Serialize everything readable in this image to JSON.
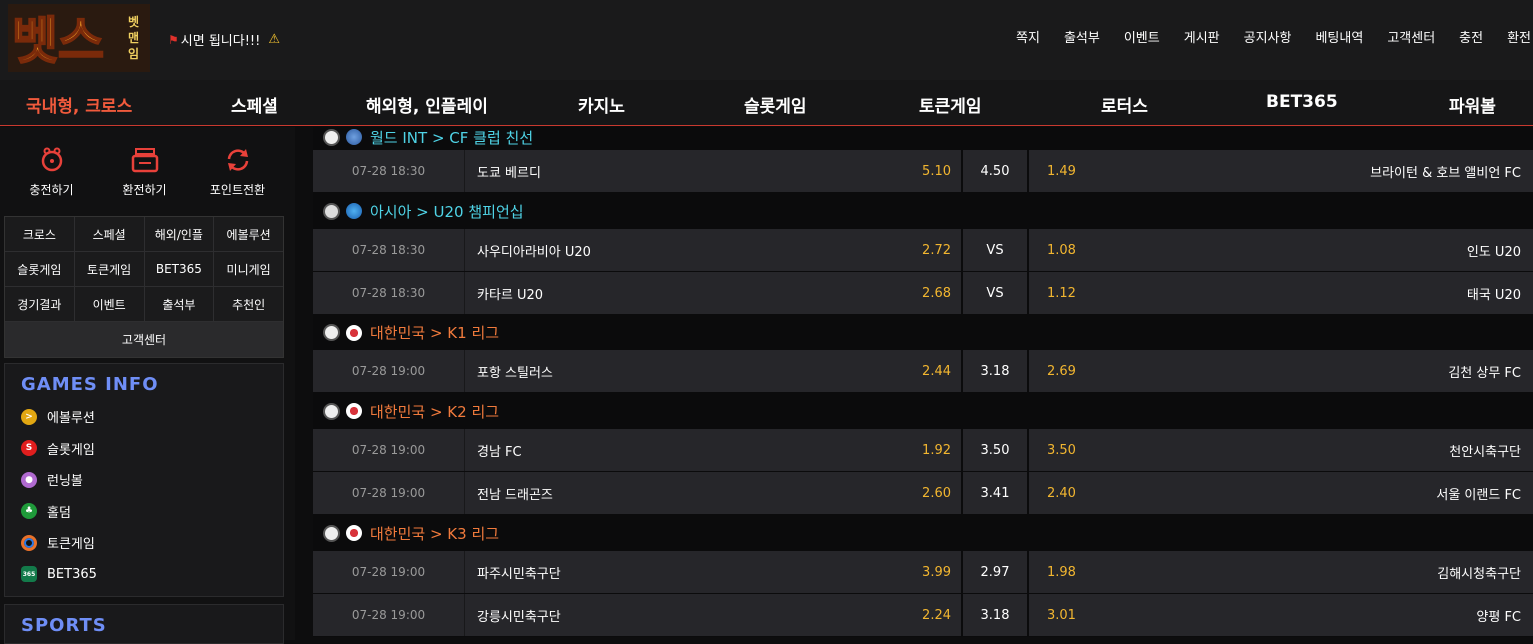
{
  "header": {
    "logo_text": "벳스",
    "logo_sub": "벳맨임신",
    "notice": "시면 됩니다!!!",
    "top_links": [
      "쪽지",
      "출석부",
      "이벤트",
      "게시판",
      "공지사항",
      "베팅내역",
      "고객센터",
      "충전",
      "환전"
    ]
  },
  "main_nav": [
    "국내형, 크로스",
    "스페셜",
    "해외형, 인플레이",
    "카지노",
    "슬롯게임",
    "토큰게임",
    "로터스",
    "BET365",
    "파워볼"
  ],
  "sidebar": {
    "quick": [
      "충전하기",
      "환전하기",
      "포인트전환"
    ],
    "grid_rows": [
      [
        "크로스",
        "스페셜",
        "해외/인플",
        "에볼루션"
      ],
      [
        "슬롯게임",
        "토큰게임",
        "BET365",
        "미니게임"
      ],
      [
        "경기결과",
        "이벤트",
        "출석부",
        "추천인"
      ]
    ],
    "grid_full": "고객센터",
    "games_info_title": "GAMES INFO",
    "games_info": [
      "에볼루션",
      "슬롯게임",
      "런닝볼",
      "홀덤",
      "토큰게임",
      "BET365"
    ],
    "sports_title": "SPORTS"
  },
  "leagues": [
    {
      "name": "월드 INT > CF 클럽 친선",
      "color": "#4fd3e6",
      "matches": [
        {
          "time": "07-28 18:30",
          "home": "도쿄 베르디",
          "home_odd": "5.10",
          "mid": "4.50",
          "away_odd": "1.49",
          "away": "브라이턴 & 호브 앨비언 FC"
        }
      ]
    },
    {
      "name": "아시아 > U20 챔피언십",
      "color": "#4fd3e6",
      "matches": [
        {
          "time": "07-28 18:30",
          "home": "사우디아라비아 U20",
          "home_odd": "2.72",
          "mid": "VS",
          "away_odd": "1.08",
          "away": "인도 U20"
        },
        {
          "time": "07-28 18:30",
          "home": "카타르 U20",
          "home_odd": "2.68",
          "mid": "VS",
          "away_odd": "1.12",
          "away": "태국 U20"
        }
      ]
    },
    {
      "name": "대한민국 > K1 리그",
      "color": "#f07a3c",
      "matches": [
        {
          "time": "07-28 19:00",
          "home": "포항 스틸러스",
          "home_odd": "2.44",
          "mid": "3.18",
          "away_odd": "2.69",
          "away": "김천 상무 FC"
        }
      ]
    },
    {
      "name": "대한민국 > K2 리그",
      "color": "#f07a3c",
      "matches": [
        {
          "time": "07-28 19:00",
          "home": "경남 FC",
          "home_odd": "1.92",
          "mid": "3.50",
          "away_odd": "3.50",
          "away": "천안시축구단"
        },
        {
          "time": "07-28 19:00",
          "home": "전남 드래곤즈",
          "home_odd": "2.60",
          "mid": "3.41",
          "away_odd": "2.40",
          "away": "서울 이랜드 FC"
        }
      ]
    },
    {
      "name": "대한민국 > K3 리그",
      "color": "#f07a3c",
      "matches": [
        {
          "time": "07-28 19:00",
          "home": "파주시민축구단",
          "home_odd": "3.99",
          "mid": "2.97",
          "away_odd": "1.98",
          "away": "김해시청축구단"
        },
        {
          "time": "07-28 19:00",
          "home": "강릉시민축구단",
          "home_odd": "2.24",
          "mid": "3.18",
          "away_odd": "3.01",
          "away": "양평 FC"
        }
      ]
    }
  ]
}
